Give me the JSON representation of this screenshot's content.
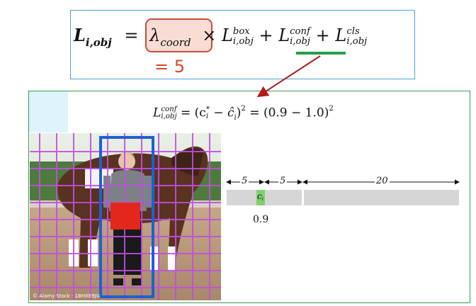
{
  "formula_top": {
    "lhs_symbol": "L",
    "lhs_subscript": "i,obj",
    "equals": "=",
    "lambda_symbol": "λ",
    "lambda_subscript": "coord",
    "times": "×",
    "term1_symbol": "L",
    "term1_sup": "box",
    "term1_sub": "i,obj",
    "plus1": "+",
    "term2_symbol": "L",
    "term2_sup": "conf",
    "term2_sub": "i,obj",
    "plus2": "+",
    "term3_symbol": "L",
    "term3_sup": "cls",
    "term3_sub": "i,obj",
    "lambda_value": "= 5"
  },
  "formula_conf": {
    "lhs_symbol": "L",
    "lhs_sup": "conf",
    "lhs_sub": "i,obj",
    "equals": "=",
    "expression": "(c",
    "c_star_sub": "i",
    "c_star_sup": "*",
    "minus": " − ",
    "c_hat": "ĉ",
    "c_hat_sub": "i",
    "squared_part": ")",
    "exp": "2",
    "equals2": " = (0.9 − 1.0)",
    "exp2": "2"
  },
  "vector": {
    "segments": [
      {
        "label": "5"
      },
      {
        "label": "5"
      },
      {
        "label": "20"
      }
    ],
    "cell_symbol": "c",
    "cell_subscript": "i",
    "value": "0.9"
  },
  "photo": {
    "caption": "© Alamy Stock · 1BHXE9JG"
  },
  "colors": {
    "top_box_border": "#4aa3d8",
    "main_box_border": "#3b9a55",
    "lambda_fill": "#f9dcd3",
    "lambda_border": "#c84c3a",
    "underline_green": "#21a04a",
    "arrow_red": "#b31b1b",
    "grid_purple": "#c04fe0",
    "bbox_blue": "#1f5fd6",
    "cell_red": "#e3271c",
    "cell_highlight": "#7cd36b",
    "bar_gray": "#d6d6d6"
  }
}
